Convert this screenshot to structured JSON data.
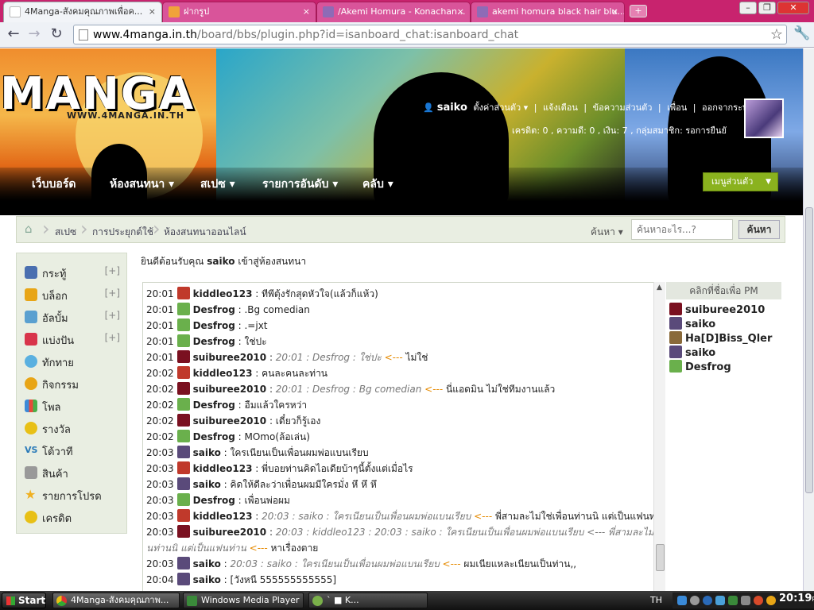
{
  "browser": {
    "tabs": [
      {
        "title": "4Manga-สังคมคุณภาพเพื่อค...",
        "active": true
      },
      {
        "title": "ฝากรูป",
        "active": false
      },
      {
        "title": "/Akemi Homura - Konachan...",
        "active": false
      },
      {
        "title": "akemi homura black hair blu...",
        "active": false
      }
    ],
    "url_host": "www.4manga.in.th",
    "url_path": "/board/bbs/plugin.php?id=isanboard_chat:isanboard_chat",
    "close_glyph": "×",
    "new_tab_glyph": "+"
  },
  "banner": {
    "logo": "MANGA",
    "logo_url": "WWW.4MANGA.IN.TH",
    "username": "saiko",
    "user_links": [
      "ตั้งค่าส่วนตัว ▾",
      "|",
      "แจ้งเตือน",
      "|",
      "ข้อความส่วนตัว",
      "|",
      "เพื่อน",
      "|",
      "ออกจากระบบ"
    ],
    "stats": "เครดิต: 0 , ความดี: 0 , เงิน: 7 , กลุ่มสมาชิก: รอการยืนยั",
    "nav": [
      "เว็บบอร์ด",
      "ห้องสนทนา ▾",
      "สเปซ ▾",
      "รายการอันดับ ▾",
      "คลับ ▾"
    ],
    "menu_button": "เมนูส่วนตัว",
    "menu_arrow": "▼"
  },
  "breadcrumb": {
    "items": [
      "สเปซ",
      "การประยุกต์ใช้",
      "ห้องสนทนาออนไลน์"
    ],
    "search_label": "ค้นหา ▾",
    "search_placeholder": "ค้นหาอะไร...?",
    "search_button": "ค้นหา"
  },
  "sidebar": {
    "items": [
      {
        "label": "กระทู้",
        "plus": "[+]",
        "icon": "topic-icon",
        "color": "#4a6fb0"
      },
      {
        "label": "บล็อก",
        "plus": "[+]",
        "icon": "blog-icon",
        "color": "#e8a516"
      },
      {
        "label": "อัลบั้ม",
        "plus": "[+]",
        "icon": "album-icon",
        "color": "#5aa0d0"
      },
      {
        "label": "แบ่งปัน",
        "plus": "[+]",
        "icon": "share-icon",
        "color": "#d8344a"
      },
      {
        "label": "ทักทาย",
        "plus": "",
        "icon": "greet-icon",
        "color": "#5ab0e0"
      },
      {
        "label": "กิจกรรม",
        "plus": "",
        "icon": "activity-icon",
        "color": "#e8a516"
      },
      {
        "label": "โพล",
        "plus": "",
        "icon": "poll-icon",
        "color": "#3c8ad8"
      },
      {
        "label": "รางวัล",
        "plus": "",
        "icon": "reward-icon",
        "color": "#e8c016"
      },
      {
        "label": "โต้วาที",
        "plus": "",
        "icon": "debate-icon",
        "color": "#2a7ab8"
      },
      {
        "label": "สินค้า",
        "plus": "",
        "icon": "cart-icon",
        "color": "#888888"
      },
      {
        "label": "รายการโปรด",
        "plus": "",
        "icon": "favorite-star-icon",
        "color": "#f0b020"
      },
      {
        "label": "เครดิต",
        "plus": "",
        "icon": "credit-icon",
        "color": "#e8c016"
      }
    ],
    "vs_glyph": "VS"
  },
  "chat": {
    "welcome_pre": "ยินดีต้อนรับคุณ",
    "welcome_name": "saiko",
    "welcome_post": "เข้าสู่ห้องสนทนา",
    "messages": [
      {
        "time": "20:01",
        "name": "kiddleo123",
        "text": "ทีพีตุ้งรักสุดหัวใจ(แล้วก็แห้ว)",
        "quote": "",
        "arrow": "",
        "avatar": "#c0392b"
      },
      {
        "time": "20:01",
        "name": "Desfrog",
        "text": ".Bg comedian",
        "quote": "",
        "arrow": "",
        "avatar": "#6ab04c"
      },
      {
        "time": "20:01",
        "name": "Desfrog",
        "text": ".=jxt",
        "quote": "",
        "arrow": "",
        "avatar": "#6ab04c"
      },
      {
        "time": "20:01",
        "name": "Desfrog",
        "text": "ใช่ปะ",
        "quote": "",
        "arrow": "",
        "avatar": "#6ab04c"
      },
      {
        "time": "20:01",
        "name": "suiburee2010",
        "text": "ไม่ใช่",
        "quote": "20:01 : Desfrog : ใช่ปะ",
        "arrow": "<---",
        "avatar": "#7a1020"
      },
      {
        "time": "20:02",
        "name": "kiddleo123",
        "text": "คนละคนละท่าน",
        "quote": "",
        "arrow": "",
        "avatar": "#c0392b"
      },
      {
        "time": "20:02",
        "name": "suiburee2010",
        "text": "นี่แอดมิน ไม่ใช่ทีมงานแล้ว",
        "quote": "20:01 : Desfrog : Bg comedian",
        "arrow": "<---",
        "avatar": "#7a1020"
      },
      {
        "time": "20:02",
        "name": "Desfrog",
        "text": "อืมแล้วใครหว่า",
        "quote": "",
        "arrow": "",
        "avatar": "#6ab04c"
      },
      {
        "time": "20:02",
        "name": "suiburee2010",
        "text": "เดี๋ยวก็รู้เอง",
        "quote": "",
        "arrow": "",
        "avatar": "#7a1020"
      },
      {
        "time": "20:02",
        "name": "Desfrog",
        "text": "MOmo(ล้อเล่น)",
        "quote": "",
        "arrow": "",
        "avatar": "#6ab04c"
      },
      {
        "time": "20:03",
        "name": "saiko",
        "text": "ใครเนียนเป็นเพื่อนผมพ่อแบนเรียบ",
        "quote": "",
        "arrow": "",
        "avatar": "#5a4a7a"
      },
      {
        "time": "20:03",
        "name": "kiddleo123",
        "text": "พี่บอยท่านคิดไอเดียบ้าๆนี้ตั้งแต่เมื่อไร",
        "quote": "",
        "arrow": "",
        "avatar": "#c0392b"
      },
      {
        "time": "20:03",
        "name": "saiko",
        "text": "คิดให้ดีละว่าเพื่อนผมมีใครมั่ง หึ หึ หึ",
        "quote": "",
        "arrow": "",
        "avatar": "#5a4a7a"
      },
      {
        "time": "20:03",
        "name": "Desfrog",
        "text": "เพื่อนพ่อผม",
        "quote": "",
        "arrow": "",
        "avatar": "#6ab04c"
      },
      {
        "time": "20:03",
        "name": "kiddleo123",
        "text": "พี่สามละไม่ใช่เพื่อนท่านนิ แต่เป็นแฟนท่าน",
        "quote": "20:03 : saiko : ใครเนียนเป็นเพื่อนผมพ่อแบนเรียบ",
        "arrow": "<---",
        "avatar": "#c0392b"
      },
      {
        "time": "20:03",
        "name": "suiburee2010",
        "text": "",
        "quote": "20:03 : kiddleo123 : 20:03 : saiko : ใครเนียนเป็นเพื่อนผมพ่อแบนเรียบ <--- พี่สามละไม่ใช่เพื่อ",
        "arrow": "",
        "avatar": "#7a1020"
      },
      {
        "time": "20:03",
        "name": "saiko",
        "text": "ผมเนียแหละเนียนเป็นท่าน,,",
        "quote": "20:03 : saiko : ใครเนียนเป็นเพื่อนผมพ่อแบนเรียบ",
        "arrow": "<---",
        "avatar": "#5a4a7a"
      },
      {
        "time": "20:04",
        "name": "saiko",
        "text": "[วังหนี 555555555555]",
        "quote": "",
        "arrow": "",
        "avatar": "#5a4a7a"
      }
    ],
    "wrap_quote": "นท่านนิ แต่เป็นแฟนท่าน",
    "wrap_arrow": "<---",
    "wrap_text": "หาเรื่องตาย",
    "separator": " : "
  },
  "online": {
    "header": "คลิกที่ชื่อเพื่อ PM",
    "users": [
      {
        "name": "suiburee2010",
        "avatar": "#7a1020"
      },
      {
        "name": "saiko",
        "avatar": "#5a4a7a"
      },
      {
        "name": "Ha[D]Biss_Qler",
        "avatar": "#8a6a3a"
      },
      {
        "name": "saiko",
        "avatar": "#5a4a7a"
      },
      {
        "name": "Desfrog",
        "avatar": "#6ab04c"
      }
    ]
  },
  "taskbar": {
    "start": "Start",
    "tasks": [
      "4Manga-สังคมคุณภาพ...",
      "Windows Media Player",
      "`  ■ K..."
    ],
    "lang": "TH",
    "clock": "20:19",
    "ampm": "PM"
  }
}
